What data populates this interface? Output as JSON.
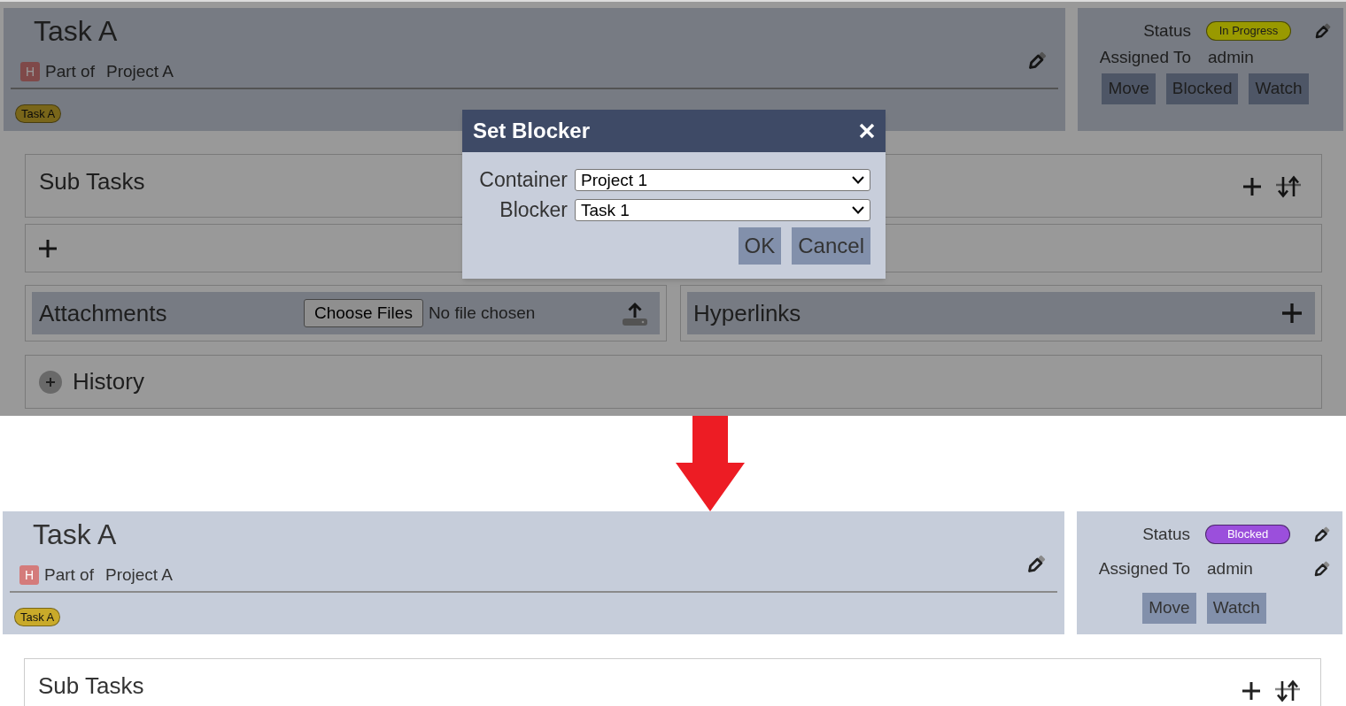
{
  "views": [
    {
      "task": {
        "title": "Task A",
        "priority": "H",
        "part_of_label": "Part of",
        "project": "Project A",
        "tags": [
          {
            "label": "Task A",
            "color": "#79661a"
          }
        ]
      },
      "details": {
        "status_label": "Status",
        "status": {
          "label": "In Progress",
          "color": "#999900"
        },
        "assigned_label": "Assigned To",
        "assignee": "admin",
        "assignee_editable": false,
        "actions": [
          "Move",
          "Blocked",
          "Watch"
        ]
      },
      "sub_tasks": {
        "title": "Sub Tasks"
      },
      "attachments": {
        "title": "Attachments",
        "file_button": "Choose Files",
        "file_status": "No file chosen"
      },
      "hyperlinks": {
        "title": "Hyperlinks"
      },
      "history": {
        "title": "History",
        "expanded": false
      },
      "dialog": {
        "title": "Set Blocker",
        "fields": [
          {
            "label": "Container",
            "value": "Project 1"
          },
          {
            "label": "Blocker",
            "value": "Task 1"
          }
        ],
        "buttons": [
          "OK",
          "Cancel"
        ]
      }
    },
    {
      "task": {
        "title": "Task A",
        "priority": "H",
        "part_of_label": "Part of",
        "project": "Project A",
        "tags": [
          {
            "label": "Task A",
            "color": "#c9aa2a"
          }
        ]
      },
      "details": {
        "status_label": "Status",
        "status": {
          "label": "Blocked",
          "color": "#9b4fdc"
        },
        "assigned_label": "Assigned To",
        "assignee": "admin",
        "assignee_editable": true,
        "actions": [
          "Move",
          "Watch"
        ]
      },
      "sub_tasks": {
        "title": "Sub Tasks"
      }
    }
  ]
}
